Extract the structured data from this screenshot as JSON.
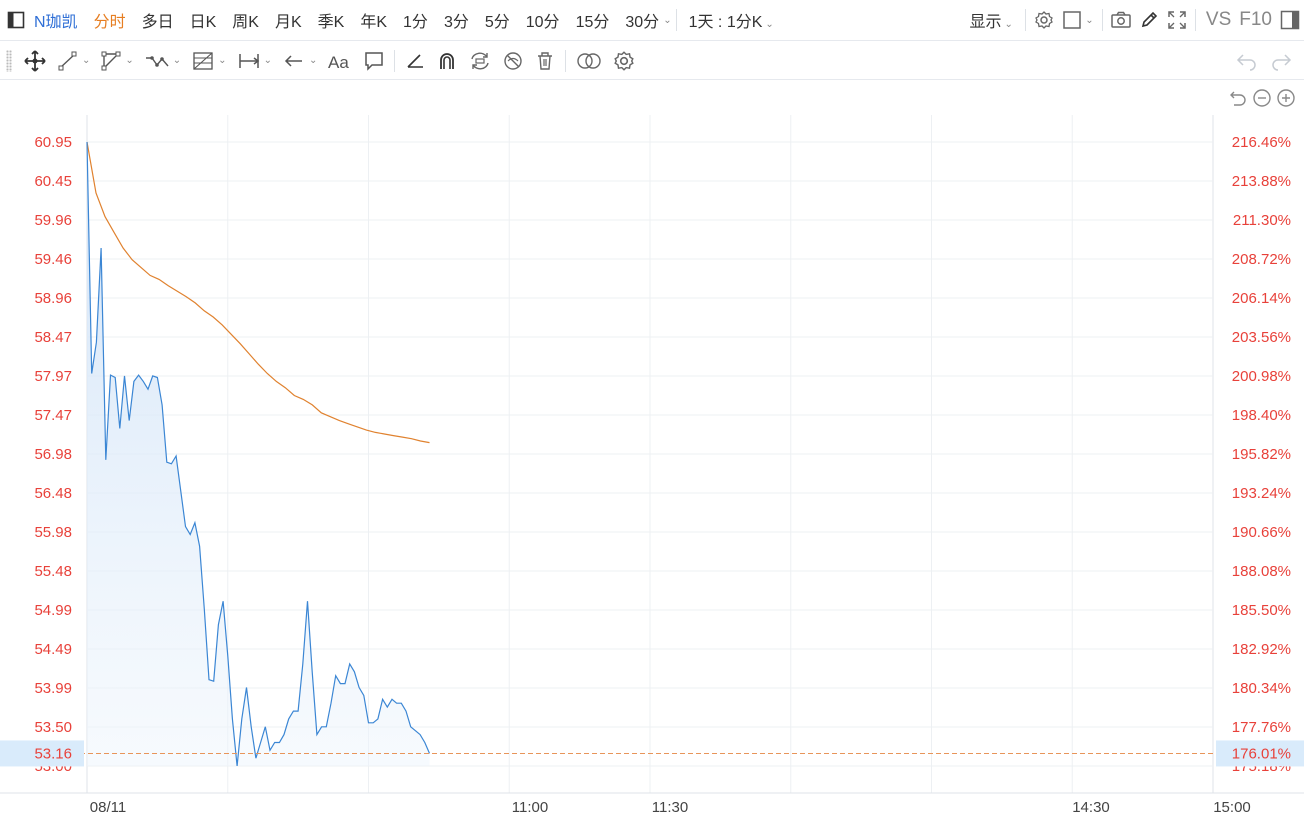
{
  "toolbar": {
    "symbol": "N珈凯",
    "periods": [
      "分时",
      "多日",
      "日K",
      "周K",
      "月K",
      "季K",
      "年K",
      "1分",
      "3分",
      "5分",
      "10分",
      "15分",
      "30分"
    ],
    "active_period": "分时",
    "range_select": "1天 : 1分K",
    "display_label": "显示",
    "vs_label": "VS",
    "f10_label": "F10"
  },
  "colors": {
    "price_line": "#3b86d4",
    "avg_line": "#e0822f",
    "axis_red": "#e8413a",
    "current_price_bg": "#d9ebfb",
    "dashed_ref": "#e8955a",
    "active_period": "#e67e22",
    "active_symbol": "#2f6fd6"
  },
  "chart_data": {
    "type": "line",
    "title": "",
    "x_tick_labels": [
      "08/11",
      "11:00",
      "11:30",
      "14:30",
      "15:00"
    ],
    "left_axis_ticks": [
      "60.95",
      "60.45",
      "59.96",
      "59.46",
      "58.96",
      "58.47",
      "57.97",
      "57.47",
      "56.98",
      "56.48",
      "55.98",
      "55.48",
      "54.99",
      "54.49",
      "53.99",
      "53.50",
      "53.00"
    ],
    "right_axis_ticks": [
      "216.46%",
      "213.88%",
      "211.30%",
      "208.72%",
      "206.14%",
      "203.56%",
      "200.98%",
      "198.40%",
      "195.82%",
      "193.24%",
      "190.66%",
      "188.08%",
      "185.50%",
      "182.92%",
      "180.34%",
      "177.76%",
      "175.18%"
    ],
    "ylim": [
      53.0,
      60.95
    ],
    "session_minutes": 240,
    "current_price": "53.16",
    "current_change": "176.01%",
    "grid": true,
    "series": [
      {
        "name": "",
        "kind": "price",
        "values": [
          60.95,
          58.0,
          58.4,
          59.6,
          56.9,
          57.98,
          57.95,
          57.3,
          57.97,
          57.4,
          57.9,
          57.98,
          57.9,
          57.8,
          57.97,
          57.95,
          57.6,
          56.87,
          56.85,
          56.95,
          56.5,
          56.05,
          55.95,
          56.1,
          55.8,
          55.0,
          54.1,
          54.08,
          54.8,
          55.1,
          54.4,
          53.6,
          53.0,
          53.6,
          54.0,
          53.5,
          53.1,
          53.3,
          53.5,
          53.2,
          53.3,
          53.3,
          53.4,
          53.6,
          53.7,
          53.7,
          54.3,
          55.1,
          54.2,
          53.4,
          53.5,
          53.5,
          53.8,
          54.15,
          54.05,
          54.05,
          54.3,
          54.2,
          54.0,
          53.9,
          53.55,
          53.55,
          53.6,
          53.85,
          53.75,
          53.85,
          53.8,
          53.8,
          53.7,
          53.5,
          53.45,
          53.4,
          53.3,
          53.16
        ]
      },
      {
        "name": "",
        "kind": "average",
        "values": [
          60.95,
          60.3,
          60.0,
          59.8,
          59.6,
          59.45,
          59.35,
          59.25,
          59.2,
          59.12,
          59.05,
          58.98,
          58.9,
          58.8,
          58.72,
          58.62,
          58.5,
          58.38,
          58.25,
          58.12,
          58.0,
          57.9,
          57.82,
          57.72,
          57.67,
          57.6,
          57.5,
          57.45,
          57.4,
          57.36,
          57.32,
          57.28,
          57.25,
          57.23,
          57.21,
          57.19,
          57.17,
          57.14,
          57.12
        ]
      }
    ]
  }
}
